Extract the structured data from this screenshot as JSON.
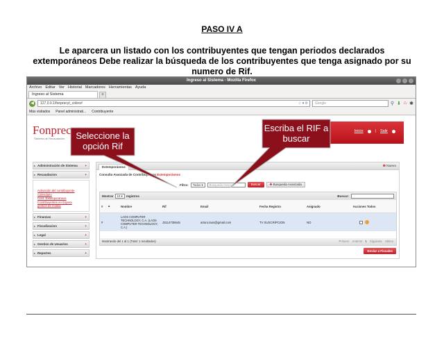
{
  "doc": {
    "title": "PASO IV A",
    "paragraph": "Le aparcera un listado con los contribuyentes que tengan periodos declarados extemporáneos Debe realizar la búsqueda de los contribuyentes que tenga asignado por su numero de Rif."
  },
  "browser": {
    "window_title": "Ingreso al Sistema - Mozilla Firefox",
    "menu": [
      "Archivo",
      "Editar",
      "Ver",
      "Historial",
      "Marcadores",
      "Herramientas",
      "Ayuda"
    ],
    "tab_label": "Ingreso al Sistema",
    "new_tab": "+",
    "url": "127.0.0.1/fonprecyt_cobro#",
    "search_placeholder": "Google",
    "bookmarks": [
      "Más visitados",
      "Panel administrati...",
      "Contribuyente"
    ]
  },
  "site": {
    "logo": "Fonprecyt",
    "logo_sub": "Sistema de Recaudación",
    "links": {
      "inicio": "Inicio",
      "salir": "Salir"
    }
  },
  "sidebar": {
    "items": [
      "Administración de Sistema",
      "Recaudacion",
      "Finanzas",
      "Fiscalizacion",
      "Legal",
      "Gestion de Usuarios",
      "Reportes"
    ],
    "recaudacion_sub": [
      "Activación del contribuyente",
      "Calendario",
      "Cont. Extemporaneos",
      "Contribuyentes en Espera",
      "gestion de multas"
    ]
  },
  "panel": {
    "tab": "Extemporáneos",
    "new": "Nuevo",
    "subtitle_prefix": "Consulta Avanzada de Contribuyentes ",
    "subtitle_highlight": "Extemporáneos",
    "filtro_label": "Filtro:",
    "filtro_value": "Todos",
    "busqueda_placeholder": "Busqueda General",
    "buscar_button": "Buscar",
    "avanzada_button": "Busqueda Avanzada"
  },
  "grid": {
    "mostrar": "Mostrar",
    "page_size": "10",
    "registros": "registros",
    "buscar_label": "Buscar:",
    "headers": [
      "#",
      "Nombre",
      "Rif",
      "Email",
      "Fecha Registro",
      "Asignado",
      "Acciones Todos"
    ],
    "rows": [
      {
        "num": "#",
        "nombre": "LAOS COMPUTER TECHNOLOGY, C.A. (LAOS COMPUTER TECHNOLOGY, C.A.)",
        "rif": "J3114735645",
        "email": "arturo.laos@gmail.com",
        "fecha": "TV SUSCRIPCION",
        "asignado": "NO"
      }
    ],
    "footer": "Mostrando del 1 al 1 (Total: 1 resultados)",
    "pager": [
      "Primero",
      "Anterior",
      "1",
      "Siguiente",
      "Ultimo"
    ],
    "enviar": "Enviar a Fiscales"
  },
  "callouts": [
    {
      "text": "Seleccione la opción Rif"
    },
    {
      "text": "Escriba el RIF a buscar"
    }
  ],
  "colors": {
    "accent": "#c0202a",
    "callout": "#8c0f1c"
  }
}
